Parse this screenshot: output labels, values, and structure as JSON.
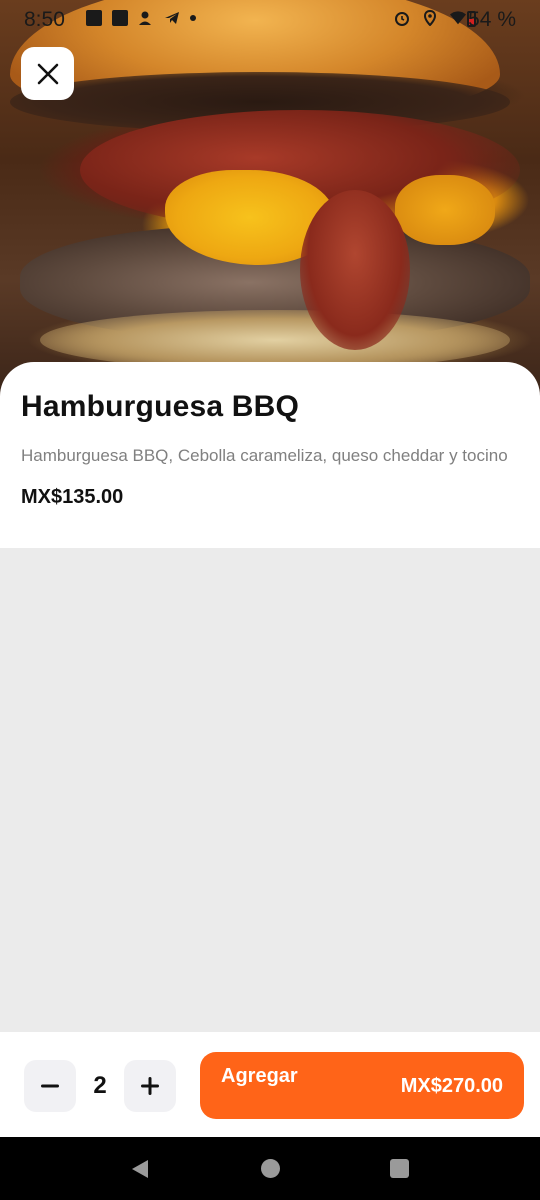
{
  "status_bar": {
    "time": "8:50",
    "battery": "54 %"
  },
  "product": {
    "image_alt": "Hamburguesa BBQ",
    "title": "Hamburguesa BBQ",
    "description": "Hamburguesa BBQ, Cebolla carameliza, queso cheddar y tocino",
    "price": "MX$135.00"
  },
  "order": {
    "quantity": "2",
    "add_label": "Agregar",
    "total": "MX$270.00"
  },
  "colors": {
    "accent": "#ff6418",
    "background": "#ebebeb"
  },
  "icons": [
    "close-icon",
    "minus-icon",
    "plus-icon",
    "nav-back-icon",
    "nav-home-icon",
    "nav-recent-icon"
  ]
}
